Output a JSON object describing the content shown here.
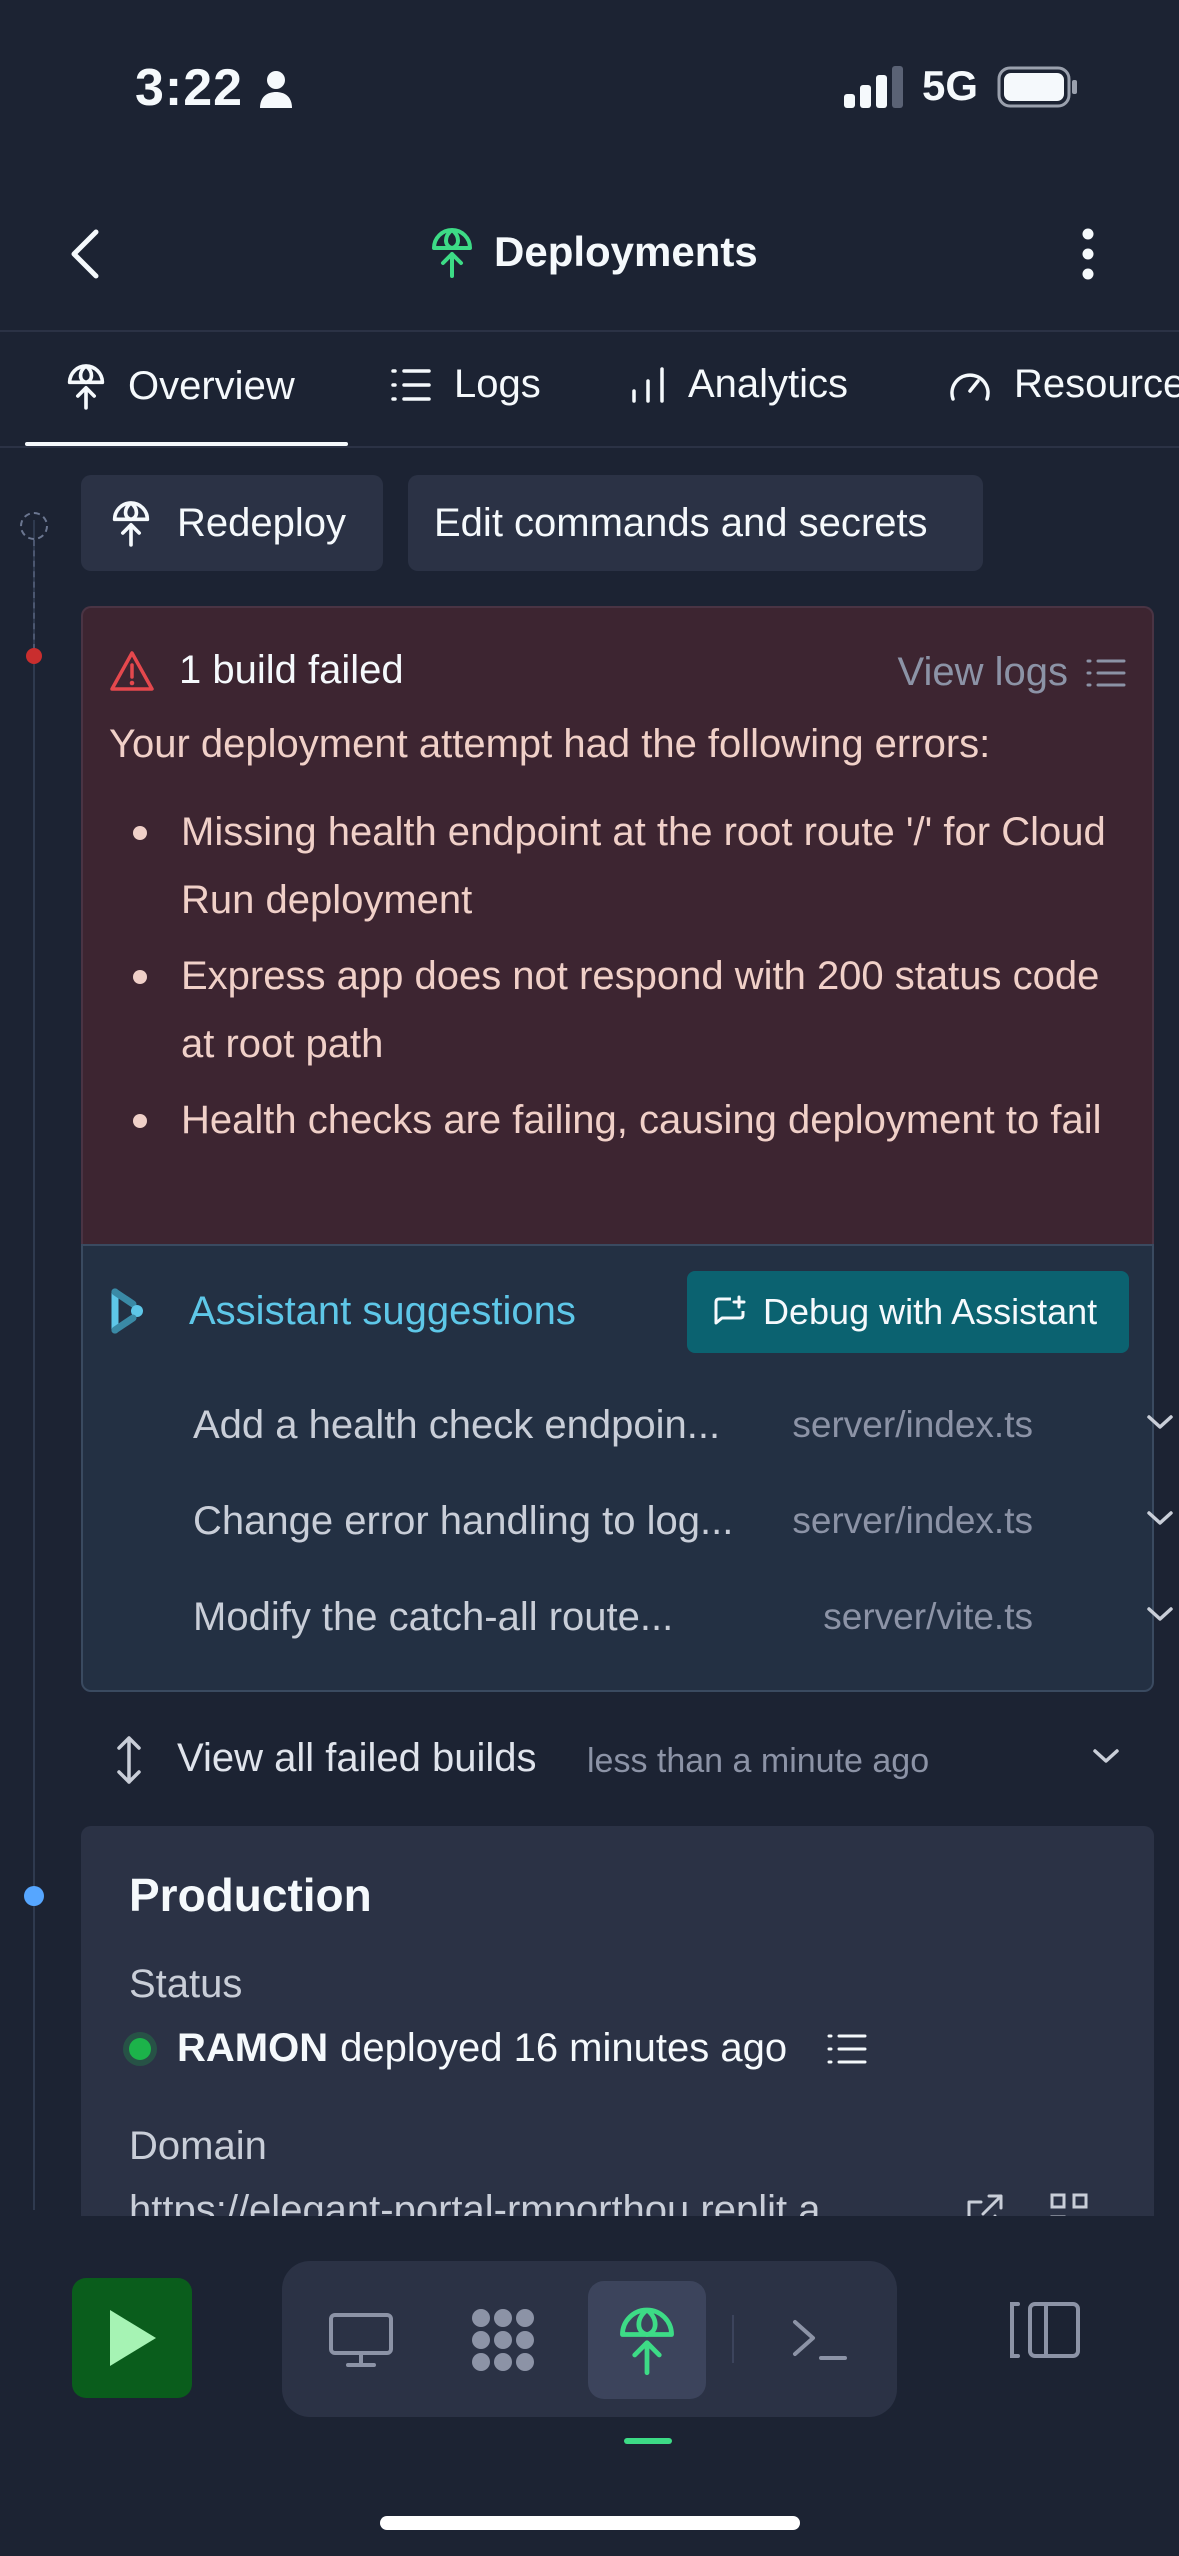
{
  "status_bar": {
    "time": "3:22",
    "network": "5G"
  },
  "header": {
    "title": "Deployments"
  },
  "tabs": [
    {
      "label": "Overview"
    },
    {
      "label": "Logs"
    },
    {
      "label": "Analytics"
    },
    {
      "label": "Resources"
    }
  ],
  "actions": {
    "redeploy": "Redeploy",
    "edit": "Edit commands and secrets"
  },
  "error": {
    "title": "1 build failed",
    "view_logs": "View logs",
    "intro": "Your deployment attempt had the following errors:",
    "items": [
      "Missing health endpoint at the root route '/' for Cloud Run deployment",
      "Express app does not respond with 200 status code at root path",
      "Health checks are failing, causing deployment to fail"
    ]
  },
  "suggestions": {
    "title": "Assistant suggestions",
    "debug_button": "Debug with Assistant",
    "items": [
      {
        "title": "Add a health check endpoin...",
        "file": "server/index.ts"
      },
      {
        "title": "Change error handling to log...",
        "file": "server/index.ts"
      },
      {
        "title": "Modify the catch-all route...",
        "file": "server/vite.ts"
      }
    ]
  },
  "failed_builds": {
    "label": "View all failed builds",
    "time": "less than a minute ago"
  },
  "production": {
    "title": "Production",
    "status_label": "Status",
    "user": "RAMON",
    "status_text": "deployed 16 minutes ago",
    "domain_label": "Domain",
    "domain": "https://elegant-portal-rmporthou.replit.a..."
  },
  "colors": {
    "background": "#1c2333",
    "error_bg": "#3d2531",
    "suggestion_bg": "#233043",
    "accent_cyan": "#5ec7e8",
    "debug_button": "#0b6270",
    "run_button": "#0a5d1c",
    "deploy_green": "#3ddb86",
    "status_green": "#1cb34a"
  }
}
